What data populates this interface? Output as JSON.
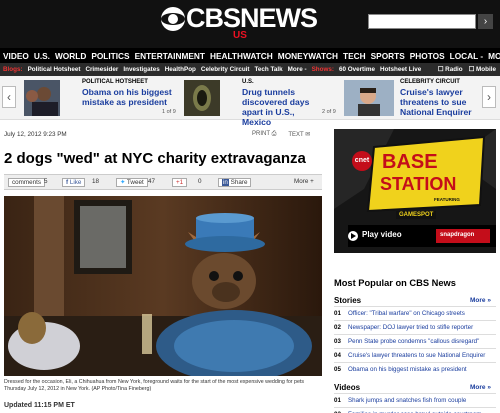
{
  "header": {
    "brand": "CBSNEWS",
    "edition": "US",
    "search_button": "›"
  },
  "nav": {
    "items": [
      "VIDEO",
      "U.S.",
      "WORLD",
      "POLITICS",
      "ENTERTAINMENT",
      "HEALTHWATCH",
      "MONEYWATCH",
      "TECH",
      "SPORTS",
      "PHOTOS",
      "LOCAL -",
      "MORE -"
    ]
  },
  "subnav": {
    "blogs_label": "Blogs:",
    "blogs": [
      "Political Hotsheet",
      "Crimesider",
      "Investigates",
      "HealthPop",
      "Celebrity Circuit",
      "Tech Talk",
      "More -"
    ],
    "shows_label": "Shows:",
    "shows": [
      "60 Overtime",
      "Hotsheet Live"
    ],
    "right": [
      "Radio",
      "Mobile"
    ]
  },
  "carousel": {
    "prev": "‹",
    "next": "›",
    "items": [
      {
        "category": "POLITICAL HOTSHEET",
        "title": "Obama on his biggest mistake as president",
        "page": "1 of 9"
      },
      {
        "category": "U.S.",
        "title": "Drug tunnels discovered days apart in U.S., Mexico",
        "page": "2 of 9"
      },
      {
        "category": "CELEBRITY CIRCUIT",
        "title": "Cruise's lawyer threatens to sue National Enquirer",
        "page": "3 of 9"
      }
    ]
  },
  "article": {
    "dateline": "July 12, 2012 9:23 PM",
    "print": "PRINT",
    "text": "TEXT",
    "headline": "2 dogs \"wed\" at NYC charity extravaganza",
    "share": {
      "comments_label": "comments",
      "comments": "5",
      "like_label": "Like",
      "likes": "18",
      "tweet_label": "Tweet",
      "tweets": "47",
      "plus_label": "+1",
      "plus": "0",
      "share_label": "Share",
      "more": "More +"
    },
    "caption": "Dressed for the occasion, Eli, a Chihuahua from New York, foreground waits for the start of the most expensive wedding for pets Thursday July 12, 2012 in New York. (AP Photo/Tina Fineberg)",
    "updated": "Updated 11:15 PM ET"
  },
  "ad": {
    "brand": "cnet",
    "title_line1": "BASE",
    "title_line2": "STATION",
    "featuring": "FEATURING",
    "sub": "GAMESPOT",
    "play": "Play video",
    "sponsor": "snapdragon"
  },
  "sidebar": {
    "most_popular": "Most Popular on CBS News",
    "stories_label": "Stories",
    "stories_more": "More »",
    "stories": [
      {
        "num": "01",
        "text": "Officer: \"Tribal warfare\" on Chicago streets"
      },
      {
        "num": "02",
        "text": "Newspaper: DOJ lawyer tried to stifle reporter"
      },
      {
        "num": "03",
        "text": "Penn State probe condemns \"callous disregard\""
      },
      {
        "num": "04",
        "text": "Cruise's lawyer threatens to sue National Enquirer"
      },
      {
        "num": "05",
        "text": "Obama on his biggest mistake as president"
      }
    ],
    "videos_label": "Videos",
    "videos_more": "More »",
    "videos": [
      {
        "num": "01",
        "text": "Shark jumps and snatches fish from couple"
      },
      {
        "num": "02",
        "text": "Families in murder case brawl outside courtroom"
      }
    ]
  }
}
